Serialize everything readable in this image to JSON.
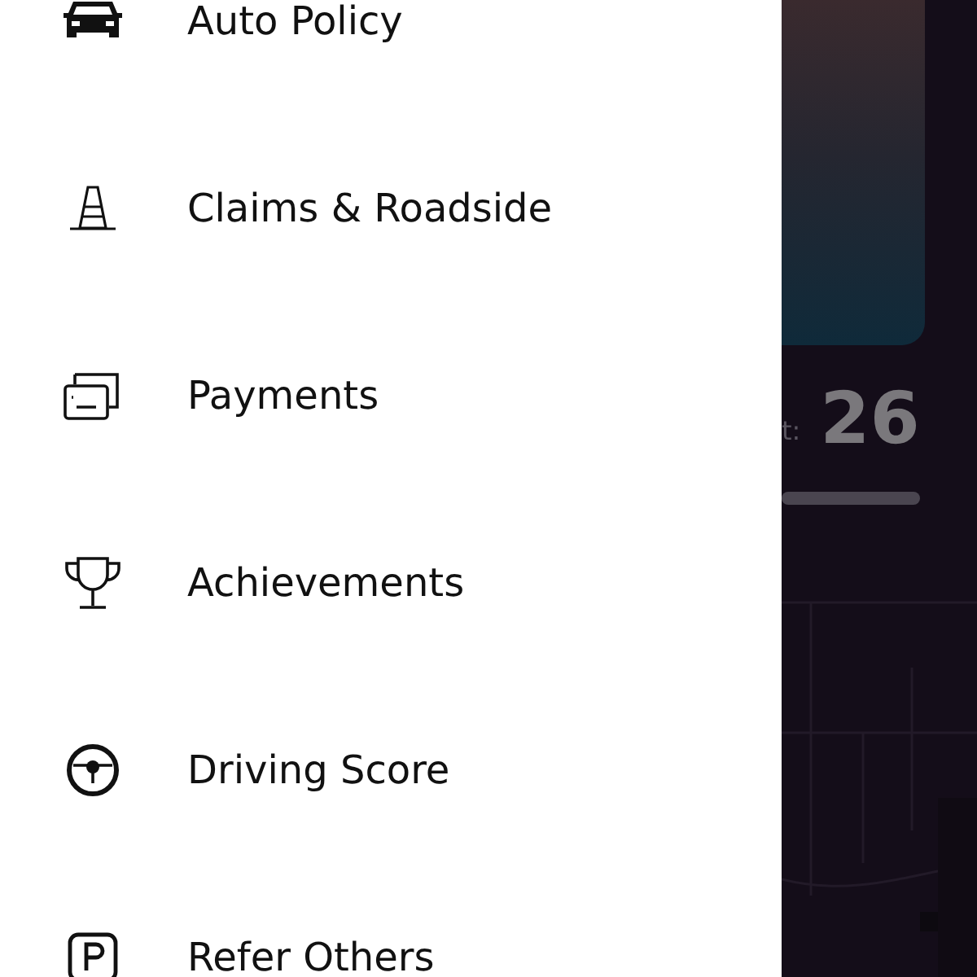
{
  "menu": {
    "items": [
      {
        "kind": "car",
        "label": "Auto Policy"
      },
      {
        "kind": "cone",
        "label": "Claims & Roadside"
      },
      {
        "kind": "cards",
        "label": "Payments"
      },
      {
        "kind": "trophy",
        "label": "Achievements"
      },
      {
        "kind": "wheel",
        "label": "Driving Score"
      },
      {
        "kind": "refer",
        "label": "Refer Others"
      }
    ]
  },
  "background": {
    "score_label": "t:",
    "score": "26"
  }
}
